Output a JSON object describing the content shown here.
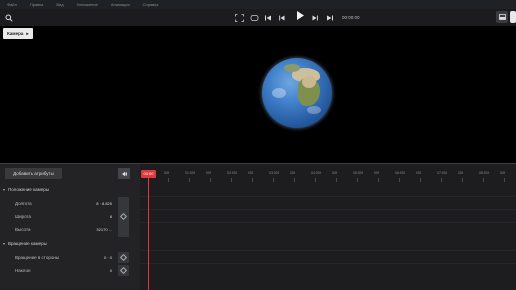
{
  "menu": [
    "Файл",
    "Правка",
    "Вид",
    "Наложение",
    "Анимация",
    "Справка"
  ],
  "toolbar": {
    "timecode": "00:00:00",
    "icons": [
      "search-icon",
      "fit-frame-icon",
      "loop-icon",
      "skip-start-icon",
      "step-back-icon",
      "play-icon",
      "step-forward-icon",
      "skip-end-icon",
      "panel-icon",
      "logo-icon"
    ]
  },
  "viewport": {
    "camera_button": "Камера",
    "camera_arrow": "▸"
  },
  "attributes": {
    "add_button": "Добавить атрибуты",
    "camera_position": {
      "title": "Положение камеры",
      "rows": [
        {
          "label": "Долгота",
          "value": "8 · 8.825"
        },
        {
          "label": "Широта",
          "value": "8"
        },
        {
          "label": "Высота",
          "value": "32170 ..."
        }
      ]
    },
    "camera_rotation": {
      "title": "Вращение камеры",
      "rows": [
        {
          "label": "Вращение в стороны",
          "value": "0 · 0"
        },
        {
          "label": "Наклон",
          "value": "0"
        }
      ]
    }
  },
  "timeline": {
    "playhead_label": "00:00",
    "ruler_labels": [
      "00f",
      "01:00f",
      "00f",
      "02:00f",
      "00f",
      "03:00f",
      "00f",
      "04:00f",
      "00f",
      "05:00f",
      "00f",
      "06:00f",
      "00f",
      "07:00f",
      "00f",
      "08:00f",
      "00f"
    ]
  },
  "colors": {
    "accent": "#e0383e",
    "panel": "#232326",
    "timeline": "#1d1d20"
  }
}
